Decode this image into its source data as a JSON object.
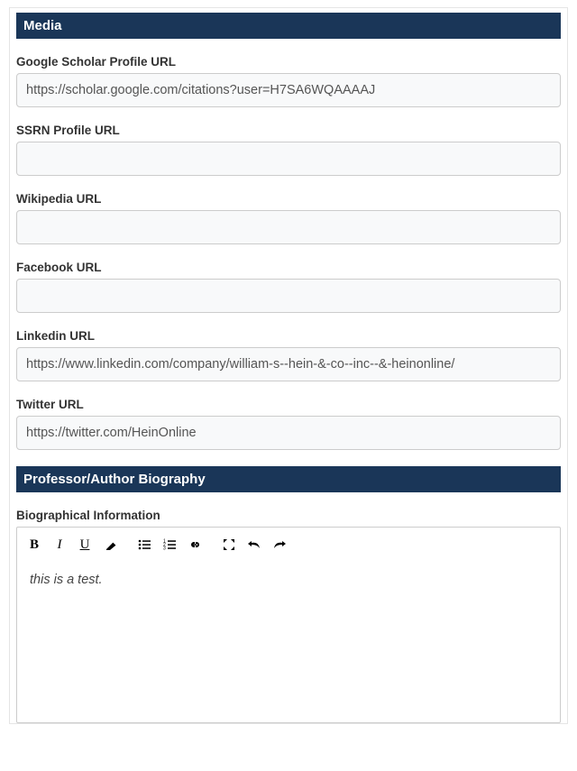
{
  "sections": {
    "media": {
      "title": "Media",
      "fields": {
        "google_scholar": {
          "label": "Google Scholar Profile URL",
          "value": "https://scholar.google.com/citations?user=H7SA6WQAAAAJ"
        },
        "ssrn": {
          "label": "SSRN Profile URL",
          "value": ""
        },
        "wikipedia": {
          "label": "Wikipedia URL",
          "value": ""
        },
        "facebook": {
          "label": "Facebook URL",
          "value": ""
        },
        "linkedin": {
          "label": "Linkedin URL",
          "value": "https://www.linkedin.com/company/william-s--hein-&-co--inc--&-heinonline/"
        },
        "twitter": {
          "label": "Twitter URL",
          "value": "https://twitter.com/HeinOnline"
        }
      }
    },
    "biography": {
      "title": "Professor/Author Biography",
      "bio_label": "Biographical Information",
      "bio_content": "this is a test."
    }
  }
}
